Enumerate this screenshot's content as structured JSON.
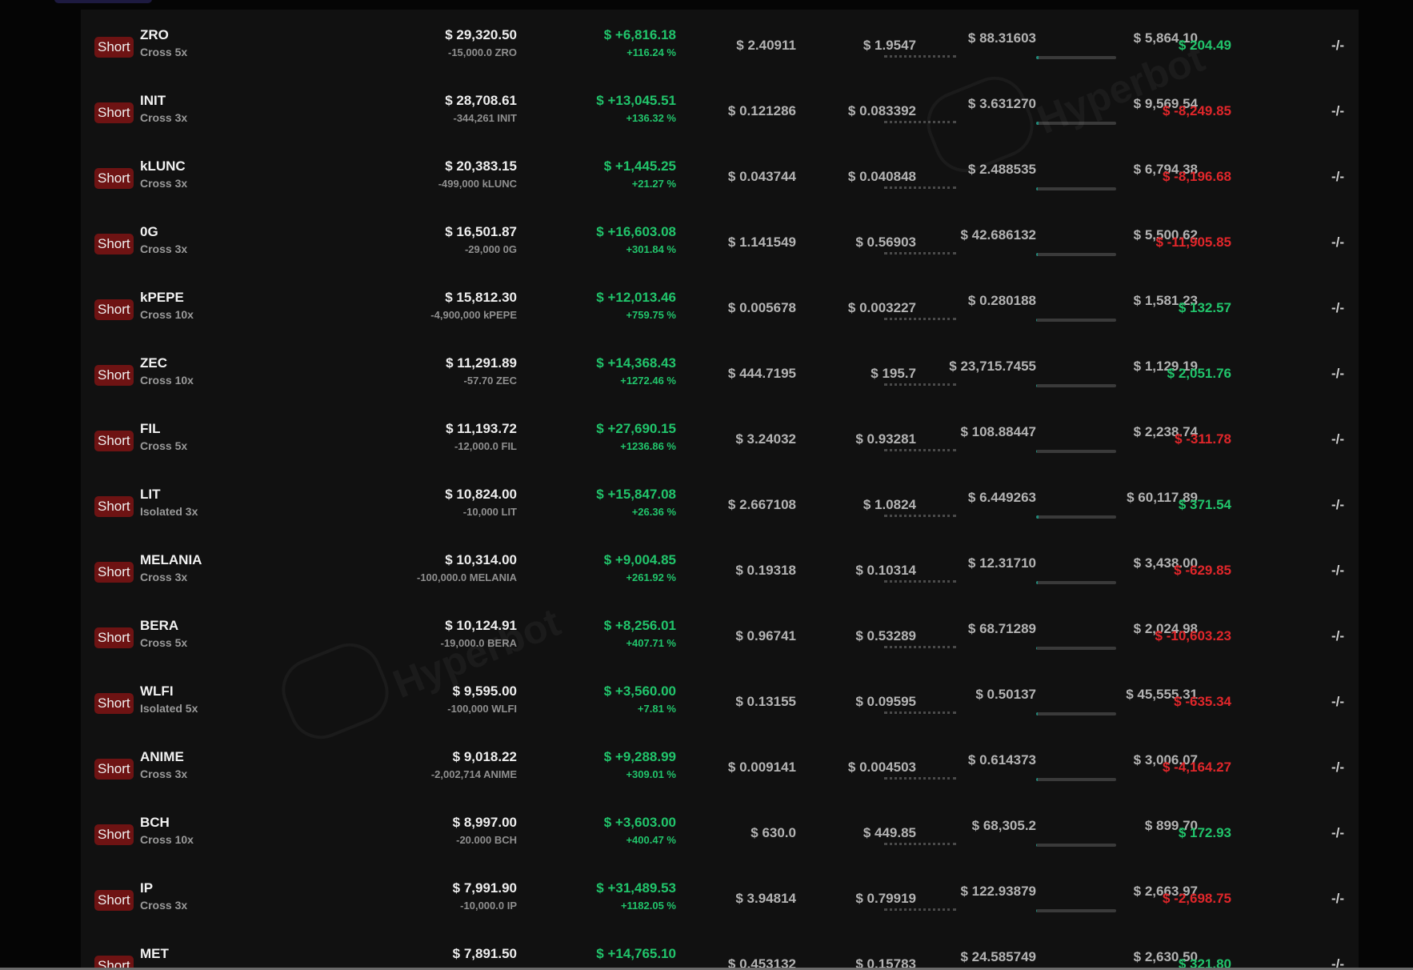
{
  "watermark": "Hyperbot",
  "colors": {
    "profit": "#21c46b",
    "loss": "#e0262a",
    "short_badge": "#6e1313",
    "panel": "#111111"
  },
  "positions": [
    {
      "side": "Short",
      "symbol": "ZRO",
      "leverage": "Cross 5x",
      "value": "$ 29,320.50",
      "size": "-15,000.0 ZRO",
      "pnl": "$ +6,816.18",
      "pnl_pct": "+116.24 %",
      "entry": "$ 2.40911",
      "mark": "$ 1.9547",
      "liq": "$ 88.31603",
      "margin": "$ 5,864.10",
      "margin_ratio": 0.03,
      "funding": "$ 204.49",
      "funding_sign": "pos",
      "tpsl": "-/-"
    },
    {
      "side": "Short",
      "symbol": "INIT",
      "leverage": "Cross 3x",
      "value": "$ 28,708.61",
      "size": "-344,261 INIT",
      "pnl": "$ +13,045.51",
      "pnl_pct": "+136.32 %",
      "entry": "$ 0.121286",
      "mark": "$ 0.083392",
      "liq": "$ 3.631270",
      "margin": "$ 9,569.54",
      "margin_ratio": 0.03,
      "funding": "$ -8,249.85",
      "funding_sign": "neg",
      "tpsl": "-/-"
    },
    {
      "side": "Short",
      "symbol": "kLUNC",
      "leverage": "Cross 3x",
      "value": "$ 20,383.15",
      "size": "-499,000 kLUNC",
      "pnl": "$ +1,445.25",
      "pnl_pct": "+21.27 %",
      "entry": "$ 0.043744",
      "mark": "$ 0.040848",
      "liq": "$ 2.488535",
      "margin": "$ 6,794.38",
      "margin_ratio": 0.02,
      "funding": "$ -8,196.68",
      "funding_sign": "neg",
      "tpsl": "-/-"
    },
    {
      "side": "Short",
      "symbol": "0G",
      "leverage": "Cross 3x",
      "value": "$ 16,501.87",
      "size": "-29,000 0G",
      "pnl": "$ +16,603.08",
      "pnl_pct": "+301.84 %",
      "entry": "$ 1.141549",
      "mark": "$ 0.56903",
      "liq": "$ 42.686132",
      "margin": "$ 5,500.62",
      "margin_ratio": 0.02,
      "funding": "$ -11,905.85",
      "funding_sign": "neg",
      "tpsl": "-/-"
    },
    {
      "side": "Short",
      "symbol": "kPEPE",
      "leverage": "Cross 10x",
      "value": "$ 15,812.30",
      "size": "-4,900,000 kPEPE",
      "pnl": "$ +12,013.46",
      "pnl_pct": "+759.75 %",
      "entry": "$ 0.005678",
      "mark": "$ 0.003227",
      "liq": "$ 0.280188",
      "margin": "$ 1,581.23",
      "margin_ratio": 0.0,
      "funding": "$ 132.57",
      "funding_sign": "pos",
      "tpsl": "-/-"
    },
    {
      "side": "Short",
      "symbol": "ZEC",
      "leverage": "Cross 10x",
      "value": "$ 11,291.89",
      "size": "-57.70 ZEC",
      "pnl": "$ +14,368.43",
      "pnl_pct": "+1272.46 %",
      "entry": "$ 444.7195",
      "mark": "$ 195.7",
      "liq": "$ 23,715.7455",
      "margin": "$ 1,129.19",
      "margin_ratio": 0.0,
      "funding": "$ 2,051.76",
      "funding_sign": "pos",
      "tpsl": "-/-"
    },
    {
      "side": "Short",
      "symbol": "FIL",
      "leverage": "Cross 5x",
      "value": "$ 11,193.72",
      "size": "-12,000.0 FIL",
      "pnl": "$ +27,690.15",
      "pnl_pct": "+1236.86 %",
      "entry": "$ 3.24032",
      "mark": "$ 0.93281",
      "liq": "$ 108.88447",
      "margin": "$ 2,238.74",
      "margin_ratio": 0.0,
      "funding": "$ -311.78",
      "funding_sign": "neg",
      "tpsl": "-/-"
    },
    {
      "side": "Short",
      "symbol": "LIT",
      "leverage": "Isolated 3x",
      "value": "$ 10,824.00",
      "size": "-10,000 LIT",
      "pnl": "$ +15,847.08",
      "pnl_pct": "+26.36 %",
      "entry": "$ 2.667108",
      "mark": "$ 1.0824",
      "liq": "$ 6.449263",
      "margin": "$ 60,117.89",
      "margin_ratio": 0.03,
      "funding": "$ 371.54",
      "funding_sign": "pos",
      "tpsl": "-/-"
    },
    {
      "side": "Short",
      "symbol": "MELANIA",
      "leverage": "Cross 3x",
      "value": "$ 10,314.00",
      "size": "-100,000.0 MELANIA",
      "pnl": "$ +9,004.85",
      "pnl_pct": "+261.92 %",
      "entry": "$ 0.19318",
      "mark": "$ 0.10314",
      "liq": "$ 12.31710",
      "margin": "$ 3,438.00",
      "margin_ratio": 0.02,
      "funding": "$ -629.85",
      "funding_sign": "neg",
      "tpsl": "-/-"
    },
    {
      "side": "Short",
      "symbol": "BERA",
      "leverage": "Cross 5x",
      "value": "$ 10,124.91",
      "size": "-19,000.0 BERA",
      "pnl": "$ +8,256.01",
      "pnl_pct": "+407.71 %",
      "entry": "$ 0.96741",
      "mark": "$ 0.53289",
      "liq": "$ 68.71289",
      "margin": "$ 2,024.98",
      "margin_ratio": 0.0,
      "funding": "$ -10,603.23",
      "funding_sign": "neg",
      "tpsl": "-/-"
    },
    {
      "side": "Short",
      "symbol": "WLFI",
      "leverage": "Isolated 5x",
      "value": "$ 9,595.00",
      "size": "-100,000 WLFI",
      "pnl": "$ +3,560.00",
      "pnl_pct": "+7.81 %",
      "entry": "$ 0.13155",
      "mark": "$ 0.09595",
      "liq": "$ 0.50137",
      "margin": "$ 45,555.31",
      "margin_ratio": 0.02,
      "funding": "$ -635.34",
      "funding_sign": "neg",
      "tpsl": "-/-"
    },
    {
      "side": "Short",
      "symbol": "ANIME",
      "leverage": "Cross 3x",
      "value": "$ 9,018.22",
      "size": "-2,002,714 ANIME",
      "pnl": "$ +9,288.99",
      "pnl_pct": "+309.01 %",
      "entry": "$ 0.009141",
      "mark": "$ 0.004503",
      "liq": "$ 0.614373",
      "margin": "$ 3,006.07",
      "margin_ratio": 0.02,
      "funding": "$ -4,164.27",
      "funding_sign": "neg",
      "tpsl": "-/-"
    },
    {
      "side": "Short",
      "symbol": "BCH",
      "leverage": "Cross 10x",
      "value": "$ 8,997.00",
      "size": "-20.000 BCH",
      "pnl": "$ +3,603.00",
      "pnl_pct": "+400.47 %",
      "entry": "$ 630.0",
      "mark": "$ 449.85",
      "liq": "$ 68,305.2",
      "margin": "$ 899.70",
      "margin_ratio": 0.0,
      "funding": "$ 172.93",
      "funding_sign": "pos",
      "tpsl": "-/-"
    },
    {
      "side": "Short",
      "symbol": "IP",
      "leverage": "Cross 3x",
      "value": "$ 7,991.90",
      "size": "-10,000.0 IP",
      "pnl": "$ +31,489.53",
      "pnl_pct": "+1182.05 %",
      "entry": "$ 3.94814",
      "mark": "$ 0.79919",
      "liq": "$ 122.93879",
      "margin": "$ 2,663.97",
      "margin_ratio": 0.0,
      "funding": "$ -2,698.75",
      "funding_sign": "neg",
      "tpsl": "-/-"
    },
    {
      "side": "Short",
      "symbol": "MET",
      "leverage": "",
      "value": "$ 7,891.50",
      "size": "",
      "pnl": "$ +14,765.10",
      "pnl_pct": "",
      "entry": "$ 0.453132",
      "mark": "$ 0.15783",
      "liq": "$ 24.585749",
      "margin": "$ 2,630.50",
      "margin_ratio": 0.0,
      "funding": "$ 321.80",
      "funding_sign": "pos",
      "tpsl": "-/-"
    }
  ]
}
